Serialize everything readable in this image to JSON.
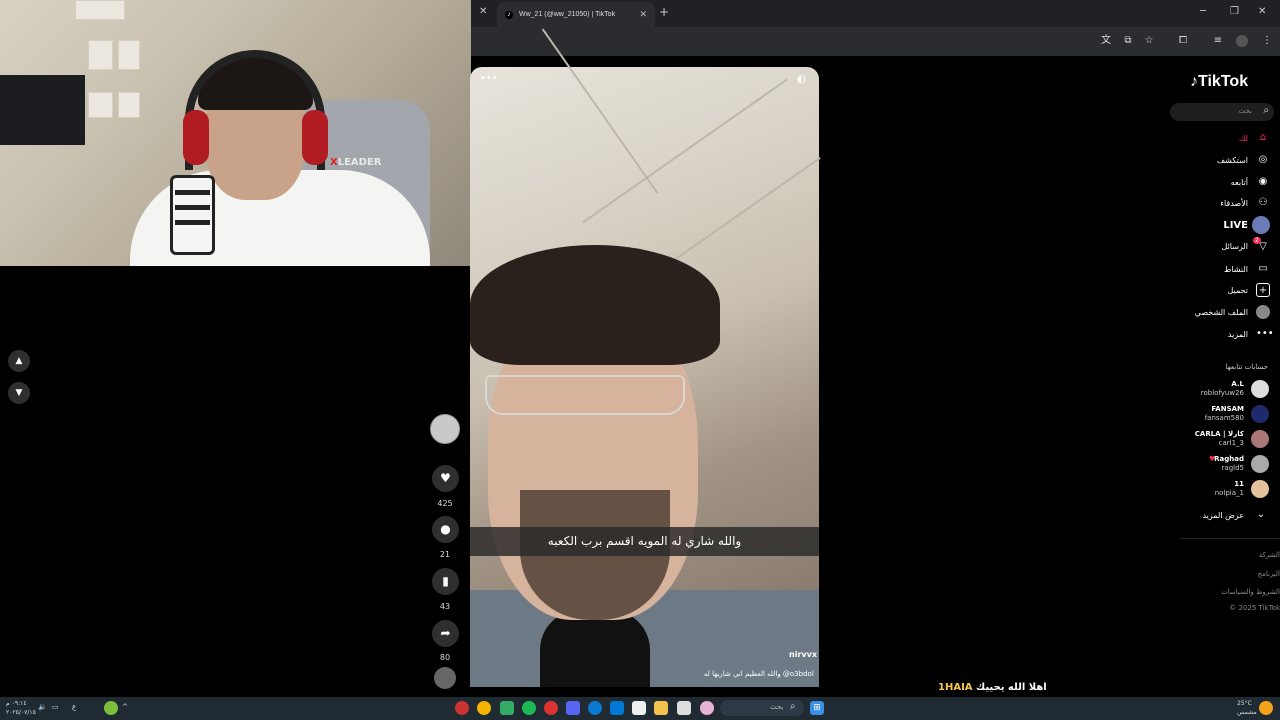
{
  "browser": {
    "tab_title": "Ww_21 (@ww_21050) | TikTok",
    "tab_favicon": "tiktok-icon",
    "new_tab_label": "+",
    "window_controls": [
      "minimize-icon",
      "restore-icon",
      "close-icon"
    ]
  },
  "video": {
    "subtitle": "والله شاري له المويه اقسم برب الكعبه",
    "username": "nirvvx",
    "caption": "والله العظيم اني شاريها له @o3bdol"
  },
  "actions": {
    "likes": "425",
    "comments": "21",
    "saves": "43",
    "shares": "80"
  },
  "sidebar": {
    "logo": "TikTok",
    "search_placeholder": "بحث",
    "nav": [
      {
        "label": "لك",
        "icon": "home-icon"
      },
      {
        "label": "استكشف",
        "icon": "compass-icon"
      },
      {
        "label": "أتابعه",
        "icon": "following-icon"
      },
      {
        "label": "الأصدقاء",
        "icon": "friends-icon"
      },
      {
        "label": "LIVE",
        "icon": "live-icon"
      },
      {
        "label": "الرسائل",
        "icon": "messages-icon",
        "badge": "2"
      },
      {
        "label": "النشاط",
        "icon": "activity-icon"
      },
      {
        "label": "تحميل",
        "icon": "upload-icon"
      },
      {
        "label": "الملف الشخصي",
        "icon": "profile-icon"
      },
      {
        "label": "المزيد",
        "icon": "more-icon"
      }
    ],
    "following_title": "حسابات تتابعها",
    "following": [
      {
        "name": "A.L",
        "handle": "roblofyuw26"
      },
      {
        "name": "FANSAM",
        "handle": "fansam580"
      },
      {
        "name": "CARLA | كارلا",
        "handle": "carl1_3"
      },
      {
        "name": "Raghad",
        "handle": "ragld5"
      },
      {
        "name": "11",
        "handle": "nolpia_1"
      }
    ],
    "see_more": "عرض المزيد",
    "footer": [
      "الشركة",
      "البرنامج",
      "الشروط والسياسات",
      "© 2025 TikTok"
    ]
  },
  "chat": {
    "name": "1HAIA",
    "message": "اهلا الله يحييك"
  },
  "taskbar": {
    "search_placeholder": "بحث",
    "weather": "25°C",
    "weather_desc": "مشمس",
    "time": "٠٩:١٤ م",
    "date": "٢٠٢٥/٠٧/١٥",
    "lang": "ع"
  },
  "chair_brand": "LEADER"
}
